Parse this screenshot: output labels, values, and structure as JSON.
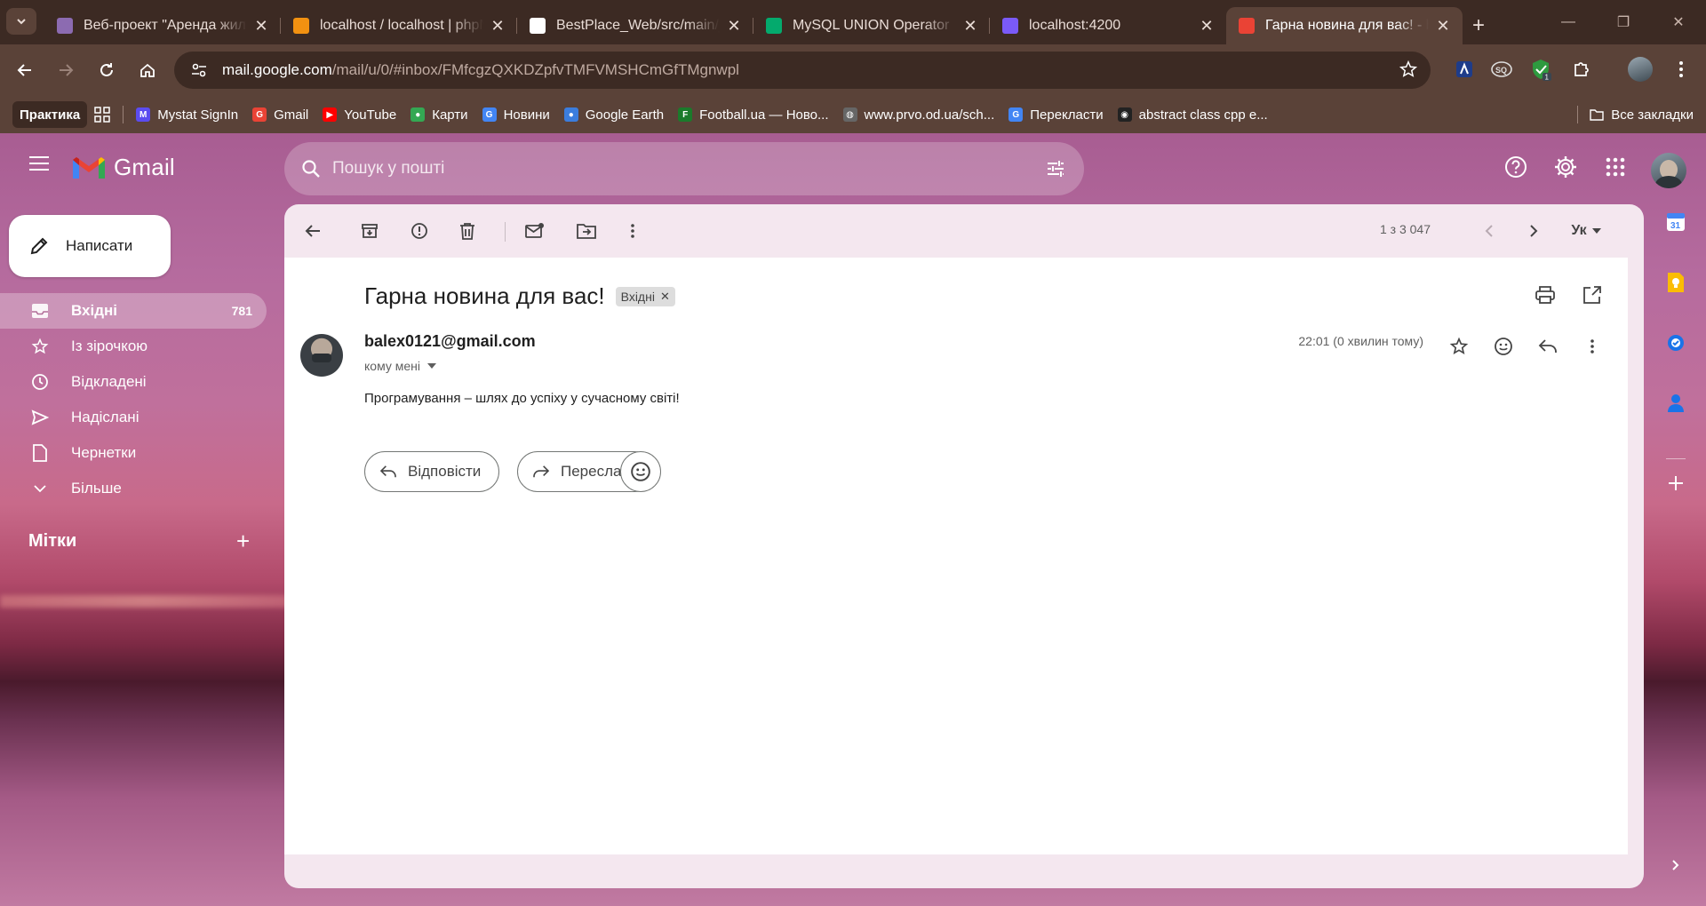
{
  "browser": {
    "tabs": [
      {
        "title": "Веб-проект \"Аренда жилья\"",
        "favicon": "doc-icon",
        "color": "#8c6bb1"
      },
      {
        "title": "localhost / localhost | phpMyAdmin",
        "favicon": "phpmyadmin-icon",
        "color": "#f29111"
      },
      {
        "title": "BestPlace_Web/src/main/java",
        "favicon": "github-icon",
        "color": "#ffffff"
      },
      {
        "title": "MySQL UNION Operator",
        "favicon": "w3schools-icon",
        "color": "#04aa6d"
      },
      {
        "title": "localhost:4200",
        "favicon": "app-icon",
        "color": "#7a5af8"
      },
      {
        "title": "Гарна новина для вас! - balex",
        "favicon": "gmail-icon",
        "color": "#ea4335"
      }
    ],
    "url_host": "mail.google.com",
    "url_path": "/mail/u/0/#inbox/FMfcgzQXKDZpfvTMFVMSHCmGfTMgnwpl",
    "bookmarks": [
      {
        "label": "Практика",
        "icon": ""
      },
      {
        "label": "Mystat SignIn",
        "icon": "M",
        "color": "#5b4cf0"
      },
      {
        "label": "Gmail",
        "icon": "G",
        "color": "#ea4335"
      },
      {
        "label": "YouTube",
        "icon": "▶",
        "color": "#ff0000"
      },
      {
        "label": "Карти",
        "icon": "●",
        "color": "#34a853"
      },
      {
        "label": "Новини",
        "icon": "G",
        "color": "#4285f4"
      },
      {
        "label": "Google Earth",
        "icon": "●",
        "color": "#3b7ddd"
      },
      {
        "label": "Football.ua — Ново...",
        "icon": "F",
        "color": "#1b7a2b"
      },
      {
        "label": "www.prvo.od.ua/sch...",
        "icon": "◍",
        "color": "#666666"
      },
      {
        "label": "Перекласти",
        "icon": "G",
        "color": "#4285f4"
      },
      {
        "label": "abstract class cpp e...",
        "icon": "◉",
        "color": "#222222"
      }
    ],
    "all_bookmarks": "Все закладки",
    "ext_badge": "1"
  },
  "gmail": {
    "brand": "Gmail",
    "search_placeholder": "Пошук у пошті",
    "compose": "Написати",
    "nav": [
      {
        "label": "Вхідні",
        "count": "781",
        "icon": "inbox-icon"
      },
      {
        "label": "Із зірочкою",
        "count": "",
        "icon": "star-icon"
      },
      {
        "label": "Відкладені",
        "count": "",
        "icon": "clock-icon"
      },
      {
        "label": "Надіслані",
        "count": "",
        "icon": "send-icon"
      },
      {
        "label": "Чернетки",
        "count": "",
        "icon": "draft-icon"
      },
      {
        "label": "Більше",
        "count": "",
        "icon": "chevron-down-icon"
      }
    ],
    "labels_heading": "Мітки",
    "pager": "1 з 3 047",
    "lang": "Ук",
    "message": {
      "subject": "Гарна новина для вас!",
      "label_chip": "Вхідні",
      "sender": "balex0121@gmail.com",
      "to": "кому мені",
      "time": "22:01 (0 хвилин тому)",
      "body": "Програмування – шлях до успіху у сучасному світі!",
      "reply": "Відповісти",
      "forward": "Переслати"
    }
  }
}
